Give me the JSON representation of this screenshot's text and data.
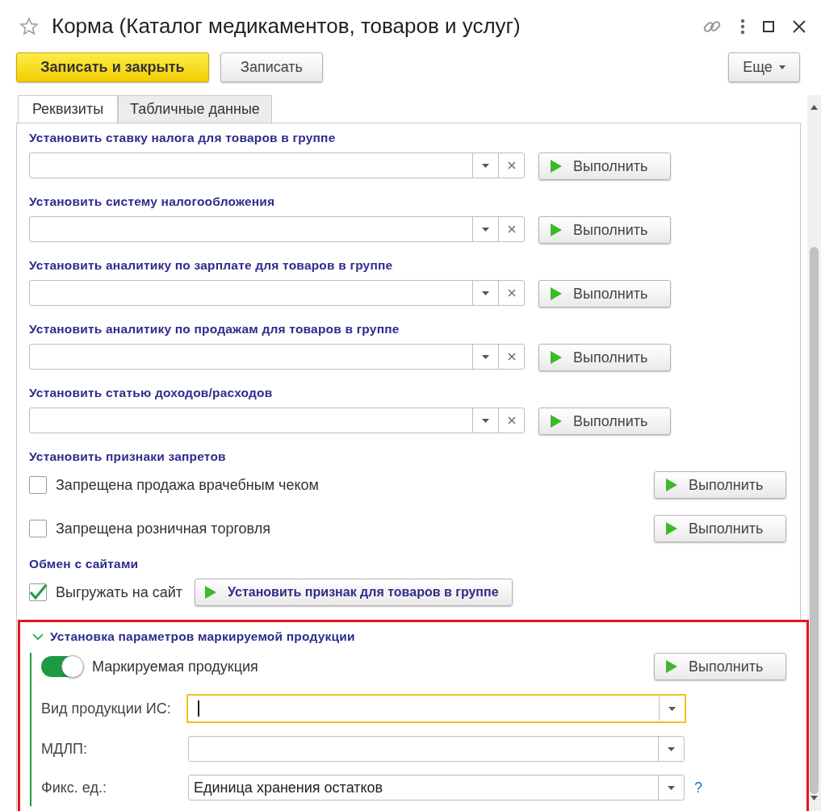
{
  "window": {
    "title": "Корма (Каталог медикаментов, товаров и услуг)"
  },
  "toolbar": {
    "buttons": [
      {
        "label": "Записать и закрыть",
        "kind": "primary"
      },
      {
        "label": "Записать",
        "kind": "default"
      }
    ],
    "more": "Еще"
  },
  "tabs": [
    {
      "label": "Реквизиты",
      "selected": true
    },
    {
      "label": "Табличные данные",
      "selected": false
    }
  ],
  "sections": [
    {
      "kind": "field",
      "title": "Установить ставку налога для товаров в группе",
      "button": "Выполнить"
    },
    {
      "kind": "field",
      "title": "Установить систему налогообложения",
      "button": "Выполнить"
    },
    {
      "kind": "field",
      "title": "Установить аналитику по зарплате для товаров в группе",
      "button": "Выполнить"
    },
    {
      "kind": "field",
      "title": "Установить аналитику по продажам для товаров в группе",
      "button": "Выполнить"
    },
    {
      "kind": "field",
      "title": "Установить статью доходов/расходов",
      "button": "Выполнить"
    },
    {
      "kind": "checks",
      "title": "Установить признаки запретов",
      "rows": [
        {
          "label": "Запрещена продажа врачебным чеком",
          "checked": false,
          "button": "Выполнить"
        },
        {
          "label": "Запрещена розничная торговля",
          "checked": false,
          "button": "Выполнить"
        }
      ]
    },
    {
      "kind": "inline_check",
      "title": "Обмен с сайтами",
      "rows": [
        {
          "label": "Выгружать на сайт",
          "checked": true,
          "button": "Установить признак для товаров в группе"
        }
      ]
    },
    {
      "kind": "group",
      "title": "Установка параметров маркируемой продукции",
      "expanded": true,
      "highlighted": true,
      "toggle": {
        "label": "Маркируемая продукция",
        "on": true,
        "button": "Выполнить"
      },
      "fields": [
        {
          "label": "Вид продукции ИС:",
          "focused": true
        },
        {
          "label": "МДЛП:",
          "focused": false
        },
        {
          "label": "Фикс. ед.:",
          "value": "Единица хранения остатков",
          "focused": false,
          "help": "?"
        }
      ]
    }
  ]
}
